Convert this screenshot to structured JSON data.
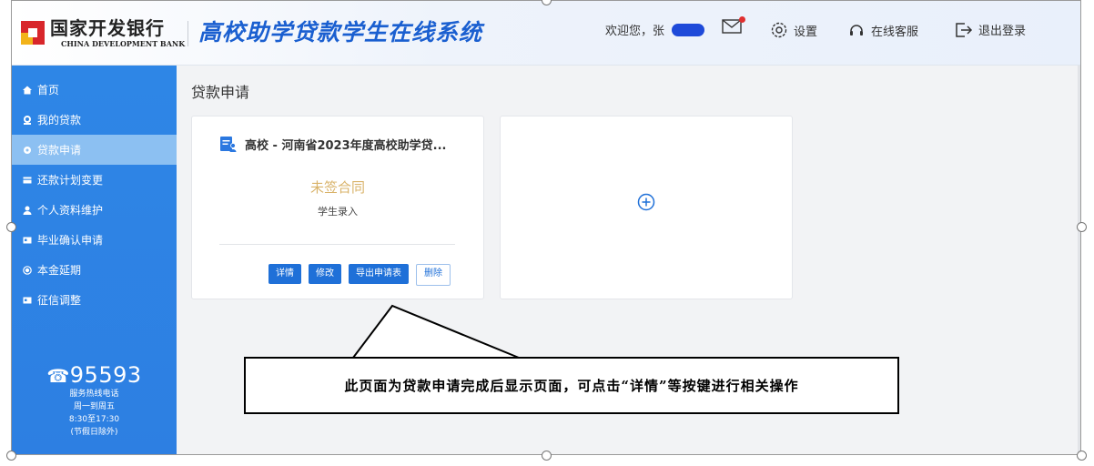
{
  "header": {
    "bank_name_cn": "国家开发银行",
    "bank_name_en": "CHINA DEVELOPMENT BANK",
    "system_title": "高校助学贷款学生在线系统",
    "welcome_text": "欢迎您，张",
    "settings_label": "设置",
    "service_label": "在线客服",
    "logout_label": "退出登录"
  },
  "sidebar": {
    "items": [
      {
        "label": "首页",
        "icon": "home-icon"
      },
      {
        "label": "我的贷款",
        "icon": "location-icon"
      },
      {
        "label": "贷款申请",
        "icon": "circle-icon",
        "active": true
      },
      {
        "label": "还款计划变更",
        "icon": "card-icon"
      },
      {
        "label": "个人资料维护",
        "icon": "user-icon"
      },
      {
        "label": "毕业确认申请",
        "icon": "id-card-icon"
      },
      {
        "label": "本金延期",
        "icon": "radio-icon"
      },
      {
        "label": "征信调整",
        "icon": "id-card-icon"
      }
    ],
    "hotline": {
      "number": "95593",
      "label": "服务热线电话",
      "days": "周一到周五",
      "hours": "8:30至17:30",
      "note": "(节假日除外)"
    }
  },
  "main": {
    "page_title": "贷款申请",
    "application_card": {
      "title": "高校 - 河南省2023年度高校助学贷...",
      "status": "未签合同",
      "sub_status": "学生录入",
      "buttons": [
        "详情",
        "修改",
        "导出申请表",
        "删除"
      ]
    }
  },
  "annotation": {
    "text": "此页面为贷款申请完成后显示页面，可点击“详情”等按键进行相关操作"
  },
  "colors": {
    "brand_blue": "#1a5fd0",
    "sidebar_blue": "#2e86e6",
    "active_item": "#8cc0f2",
    "status_gold": "#d9b36a",
    "notification_red": "#e0302f"
  }
}
